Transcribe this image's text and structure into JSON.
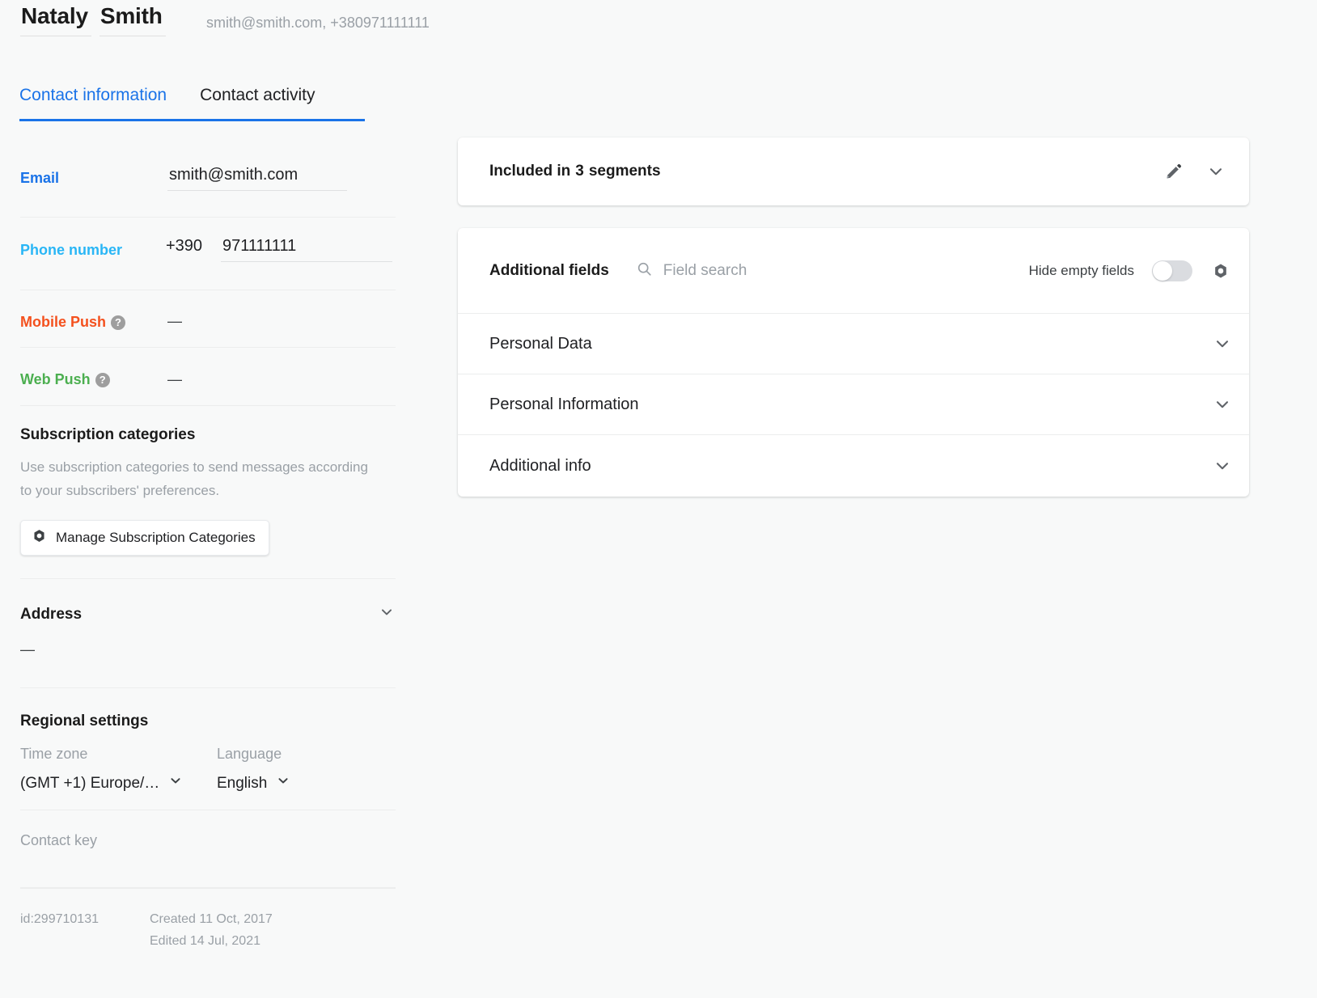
{
  "header": {
    "first_name": "Nataly",
    "last_name": "Smith",
    "subtitle": "smith@smith.com, +380971111111"
  },
  "tabs": [
    {
      "label": "Contact information",
      "active": true
    },
    {
      "label": "Contact activity",
      "active": false
    }
  ],
  "contact_fields": {
    "email": {
      "label": "Email",
      "value": "smith@smith.com",
      "color": "#1a73e8"
    },
    "phone": {
      "label": "Phone number",
      "country_code": "+390",
      "value": "971111111",
      "color": "#29b6f6"
    },
    "mobile_push": {
      "label": "Mobile Push",
      "help_icon": "question-mark-icon",
      "value": "—",
      "color": "#f4511e"
    },
    "web_push": {
      "label": "Web Push",
      "help_icon": "question-mark-icon",
      "value": "—",
      "color": "#4caf50"
    }
  },
  "subscription": {
    "title": "Subscription categories",
    "description": "Use subscription categories to send messages according to your subscribers' preferences.",
    "button_label": "Manage Subscription Categories",
    "button_icon": "gear-icon"
  },
  "address": {
    "title": "Address",
    "value": "—",
    "chevron_icon": "chevron-down-icon"
  },
  "regional": {
    "title": "Regional settings",
    "timezone_label": "Time zone",
    "timezone_value": "(GMT +1) Europe/…",
    "language_label": "Language",
    "language_value": "English"
  },
  "contact_key": {
    "label": "Contact key",
    "value": ""
  },
  "meta": {
    "id": "id:299710131",
    "created": "Created 11 Oct, 2017",
    "edited": "Edited 14 Jul, 2021"
  },
  "segments_card": {
    "prefix": "Included in",
    "count": "3",
    "suffix": "segments",
    "edit_icon": "pencil-icon",
    "chevron_icon": "chevron-down-icon"
  },
  "additional_fields": {
    "title": "Additional fields",
    "search_icon": "search-icon",
    "search_placeholder": "Field search",
    "search_value": "",
    "hide_empty_label": "Hide empty fields",
    "hide_empty_enabled": false,
    "settings_icon": "gear-icon",
    "groups": [
      {
        "label": "Personal Data",
        "chevron_icon": "chevron-down-icon"
      },
      {
        "label": "Personal Information",
        "chevron_icon": "chevron-down-icon"
      },
      {
        "label": "Additional info",
        "chevron_icon": "chevron-down-icon"
      }
    ]
  },
  "colors": {
    "accent": "#1a73e8",
    "page_bg": "#f8f9f9",
    "card_bg": "#ffffff",
    "muted_text": "#9aa0a6",
    "divider": "#eceded"
  }
}
